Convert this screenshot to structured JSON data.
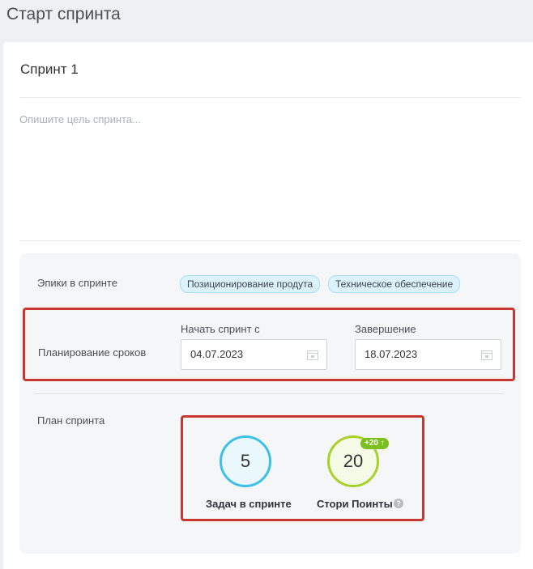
{
  "page": {
    "title": "Старт спринта"
  },
  "sprint": {
    "name": "Спринт 1",
    "goal_placeholder": "Опишите цель спринта..."
  },
  "epics": {
    "label": "Эпики в спринте",
    "items": [
      "Позиционирование продута",
      "Техническое обеспечение"
    ]
  },
  "schedule": {
    "label": "Планирование сроков",
    "start_label": "Начать спринт с",
    "start_value": "04.07.2023",
    "end_label": "Завершение",
    "end_value": "18.07.2023"
  },
  "plan": {
    "label": "План спринта",
    "tasks_count": "5",
    "tasks_label": "Задач в спринте",
    "points_count": "20",
    "points_label": "Стори Поинты",
    "points_badge": "+20 ↑"
  },
  "colors": {
    "highlight": "#c8372d",
    "tasks_circle": "#3ec0e6",
    "points_circle": "#a9d12a",
    "badge": "#7cbf1e",
    "chip": "#dcf3fb"
  }
}
